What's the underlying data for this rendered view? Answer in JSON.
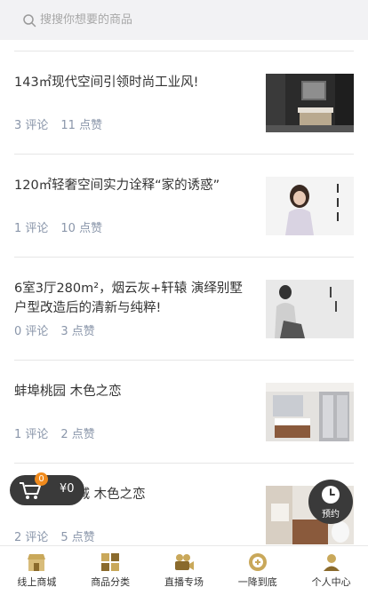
{
  "search": {
    "placeholder": "搜搜你想要的商品"
  },
  "articles": [
    {
      "title": "143㎡现代空间引领时尚工业风!",
      "comments": "3 评论",
      "likes": "11 点赞"
    },
    {
      "title": "120㎡轻奢空间实力诠释“家的诱惑”",
      "comments": "1 评论",
      "likes": "10 点赞"
    },
    {
      "title": "6室3厅280m²，烟云灰+轩辕 演绎别墅户型改造后的清新与纯粹!",
      "comments": "0 评论",
      "likes": "3 点赞"
    },
    {
      "title": "蚌埠桃园 木色之恋",
      "comments": "1 评论",
      "likes": "2 点赞"
    },
    {
      "title": "新城 木色之恋",
      "comments": "2 评论",
      "likes": "5 点赞"
    }
  ],
  "cart": {
    "count": "0",
    "price": "¥0"
  },
  "booking": {
    "label": "预约"
  },
  "tabbar": [
    {
      "label": "线上商城",
      "icon": "store-icon"
    },
    {
      "label": "商品分类",
      "icon": "category-icon"
    },
    {
      "label": "直播专场",
      "icon": "live-camera-icon"
    },
    {
      "label": "一降到底",
      "icon": "discount-icon"
    },
    {
      "label": "个人中心",
      "icon": "user-icon"
    }
  ],
  "colors": {
    "accent": "#c9a85a",
    "meta": "#8a96aa",
    "dark": "#3a3a3a",
    "badge": "#f08a1c"
  }
}
